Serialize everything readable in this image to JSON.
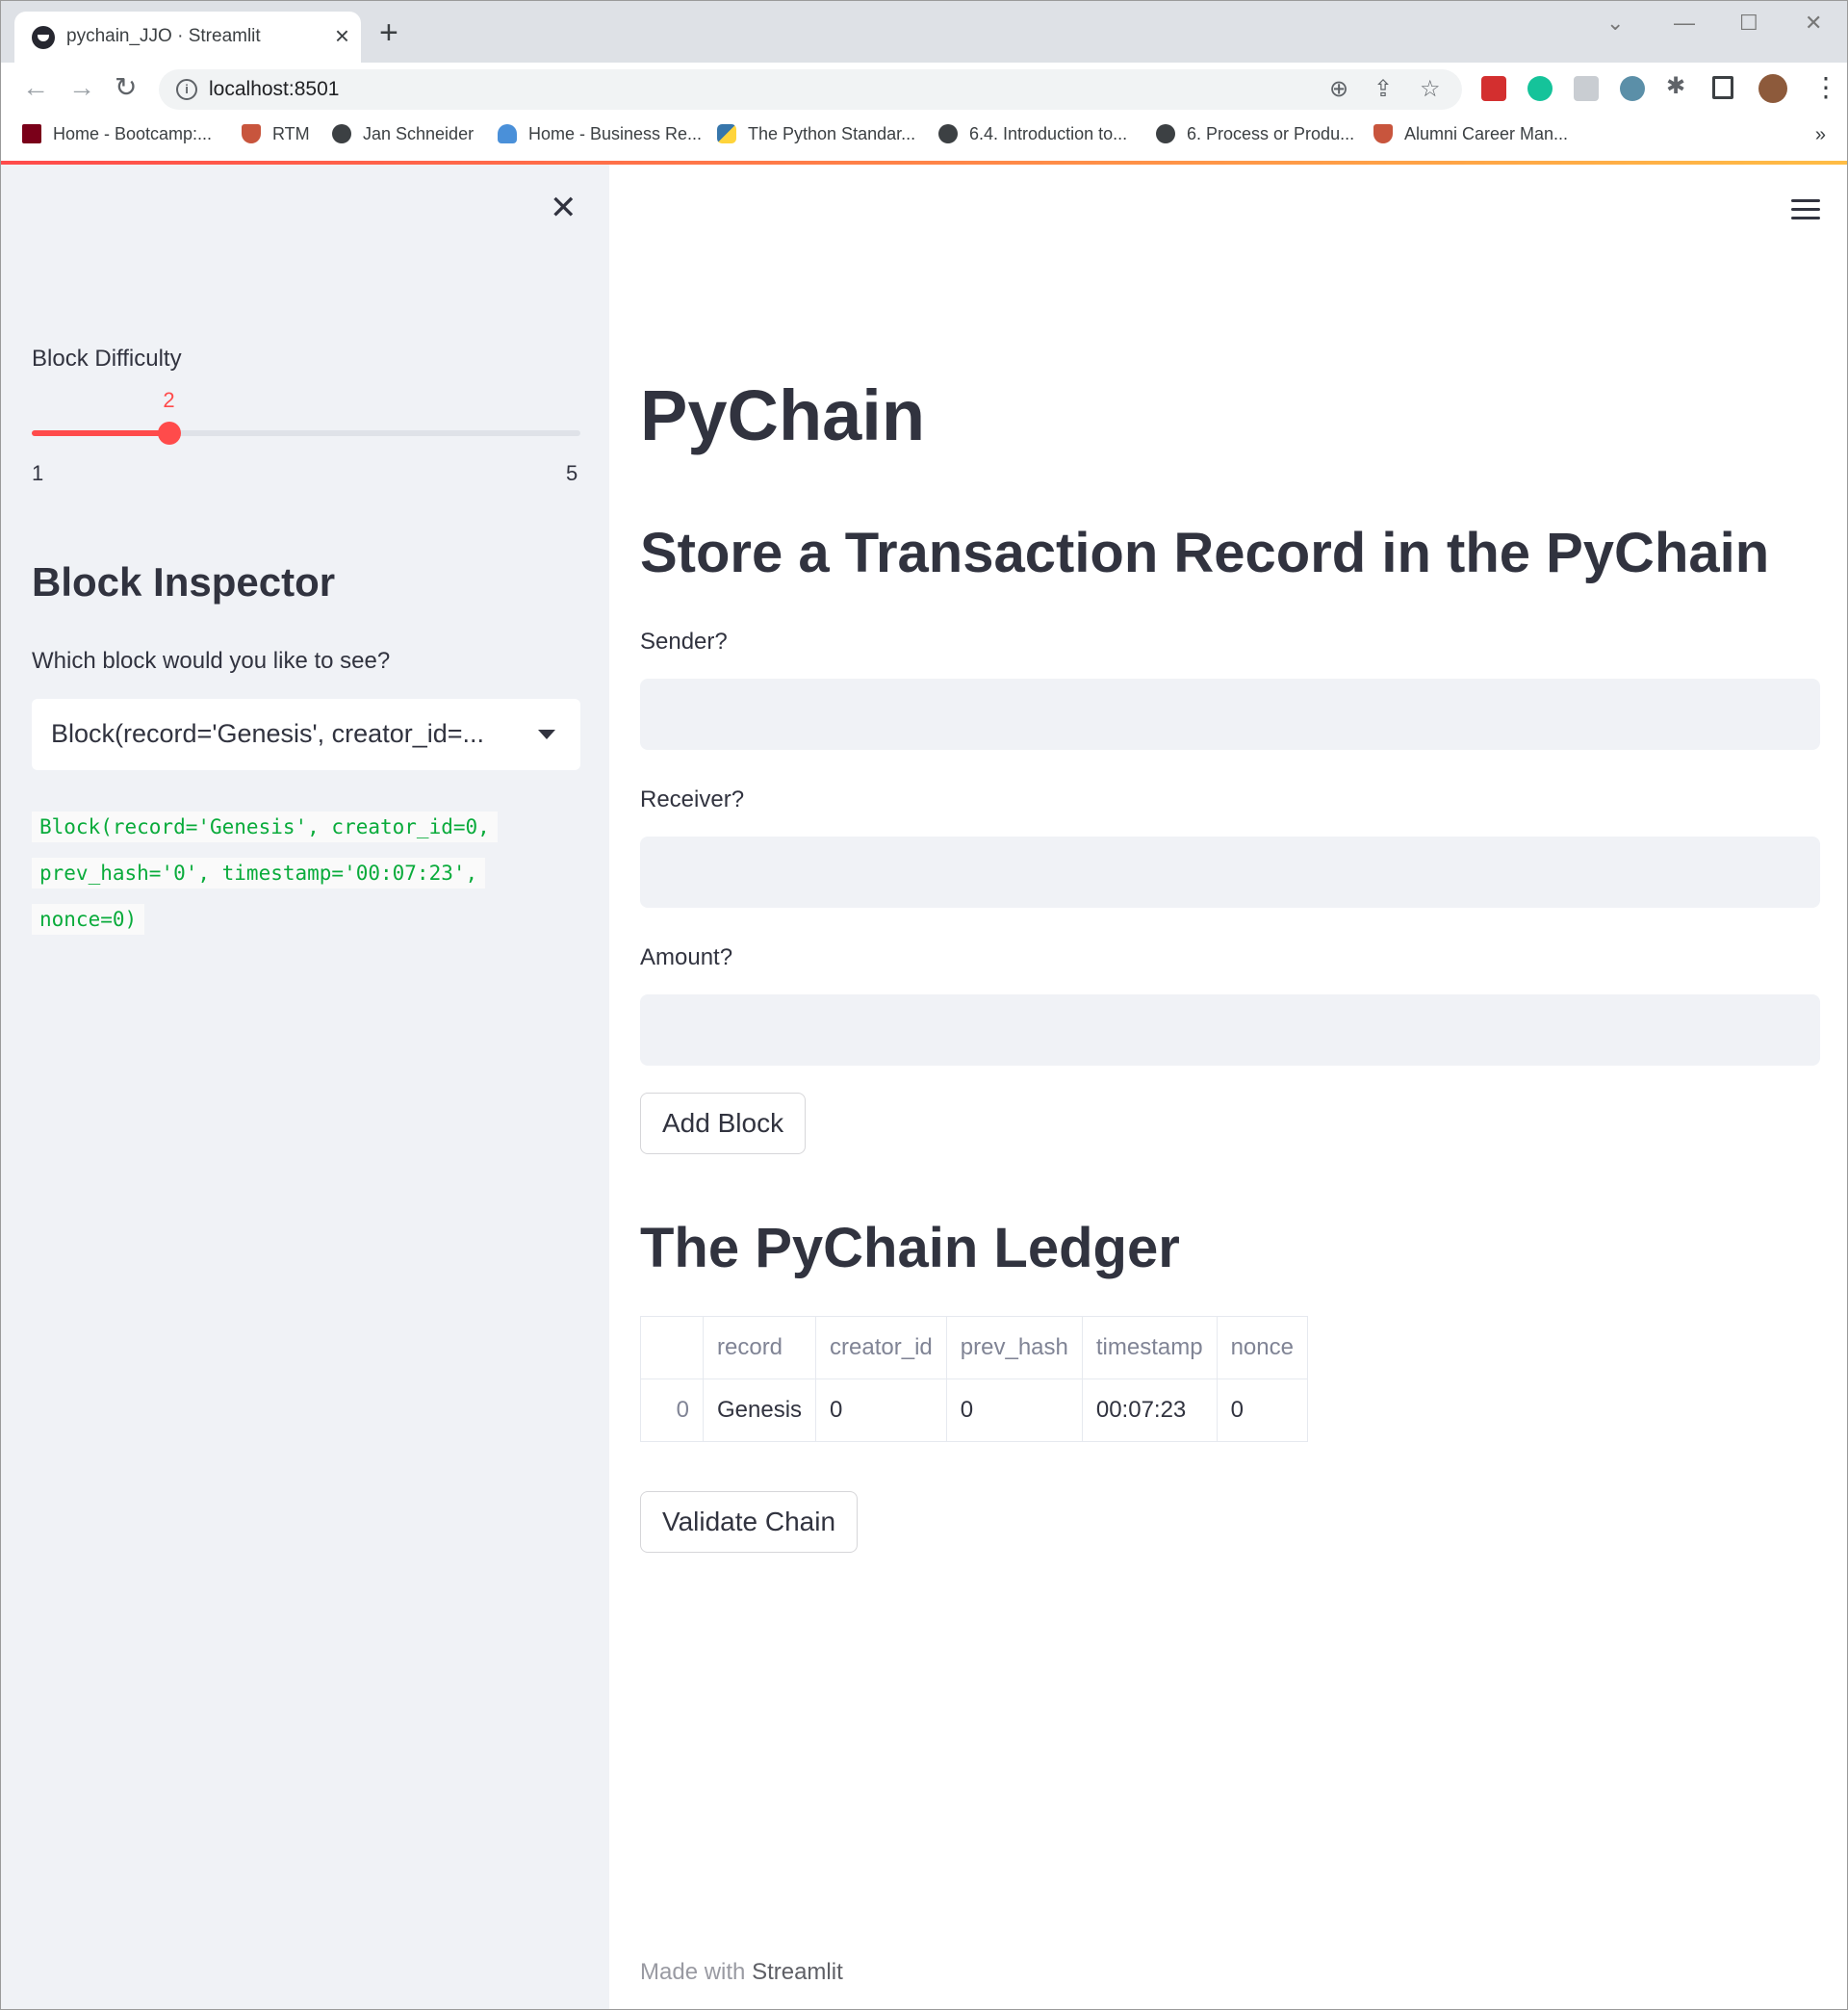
{
  "browser": {
    "tab_title": "pychain_JJO · Streamlit",
    "new_tab": "+",
    "url": "localhost:8501",
    "bookmarks": [
      {
        "label": "Home - Bootcamp:...",
        "icon": "university-logo-icon",
        "color": "#7a0019"
      },
      {
        "label": "RTM",
        "icon": "shield-icon",
        "color": "#c8553d"
      },
      {
        "label": "Jan Schneider",
        "icon": "globe-icon",
        "color": "#3c4043"
      },
      {
        "label": "Home - Business Re...",
        "icon": "cloud-icon",
        "color": "#4a90d9"
      },
      {
        "label": "The Python Standar...",
        "icon": "python-icon",
        "color": "#3776ab"
      },
      {
        "label": "6.4. Introduction to...",
        "icon": "globe-icon",
        "color": "#3c4043"
      },
      {
        "label": "6. Process or Produ...",
        "icon": "globe-icon",
        "color": "#3c4043"
      },
      {
        "label": "Alumni Career Man...",
        "icon": "shield-icon",
        "color": "#c8553d"
      }
    ],
    "bookmarks_more": "»"
  },
  "sidebar": {
    "slider": {
      "label": "Block Difficulty",
      "value": "2",
      "min": "1",
      "max": "5",
      "fraction": 0.25
    },
    "heading": "Block Inspector",
    "select_label": "Which block would you like to see?",
    "select_value": "Block(record='Genesis', creator_id=...",
    "code_lines": [
      "Block(record='Genesis', creator_id=0,",
      "prev_hash='0', timestamp='00:07:23',",
      "nonce=0)"
    ]
  },
  "main": {
    "title": "PyChain",
    "form_heading": "Store a Transaction Record in the PyChain",
    "sender_label": "Sender?",
    "receiver_label": "Receiver?",
    "amount_label": "Amount?",
    "add_button": "Add Block",
    "ledger_heading": "The PyChain Ledger",
    "table": {
      "columns": [
        "",
        "record",
        "creator_id",
        "prev_hash",
        "timestamp",
        "nonce"
      ],
      "rows": [
        [
          "0",
          "Genesis",
          "0",
          "0",
          "00:07:23",
          "0"
        ]
      ]
    },
    "validate_button": "Validate Chain",
    "footer_prefix": "Made with",
    "footer_brand": "Streamlit"
  },
  "colors": {
    "accent": "#ff4b4b",
    "code_green": "#09ab3b",
    "sidebar_bg": "#f0f2f6"
  }
}
